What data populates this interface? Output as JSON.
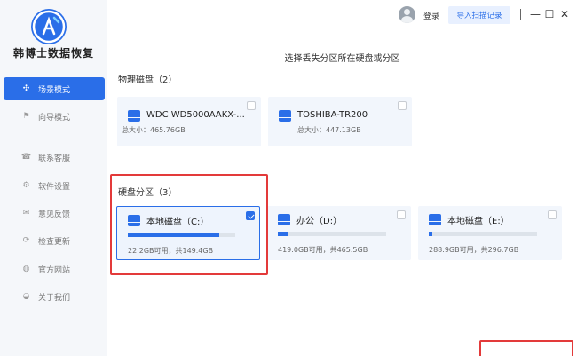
{
  "app": {
    "title": "韩博士数据恢复"
  },
  "sidebar": {
    "items": [
      {
        "label": "场景模式",
        "icon": "scene-icon",
        "glyph": "✣"
      },
      {
        "label": "向导模式",
        "icon": "flag-icon",
        "glyph": "⚑"
      },
      {
        "label": "联系客服",
        "icon": "headset-icon",
        "glyph": "☎"
      },
      {
        "label": "软件设置",
        "icon": "gear-icon",
        "glyph": "⚙"
      },
      {
        "label": "意见反馈",
        "icon": "feedback-icon",
        "glyph": "✉"
      },
      {
        "label": "检查更新",
        "icon": "update-icon",
        "glyph": "⟳"
      },
      {
        "label": "官方网站",
        "icon": "globe-icon",
        "glyph": "◍"
      },
      {
        "label": "关于我们",
        "icon": "info-icon",
        "glyph": "◒"
      }
    ]
  },
  "topbar": {
    "login": "登录",
    "import": "导入扫描记录",
    "separator": "|",
    "minimize": "—",
    "maximize": "☐",
    "close": "✕"
  },
  "main": {
    "heading": "选择丢失分区所在硬盘或分区",
    "physical_title": "物理磁盘（2）",
    "physical_disks": [
      {
        "name": "WDC WD5000AAKX-...",
        "size": "总大小：465.76GB",
        "checked": false
      },
      {
        "name": "TOSHIBA-TR200",
        "size": "总大小：447.13GB",
        "checked": false
      }
    ],
    "partition_title": "硬盘分区（3）",
    "partitions": [
      {
        "name": "本地磁盘（C:）",
        "size": "22.2GB可用，共149.4GB",
        "used_fraction": 0.85,
        "checked": true
      },
      {
        "name": "办公（D:）",
        "size": "419.0GB可用，共465.5GB",
        "used_fraction": 0.1,
        "checked": false
      },
      {
        "name": "本地磁盘（E:）",
        "size": "288.9GB可用，共296.7GB",
        "used_fraction": 0.03,
        "checked": false
      }
    ]
  },
  "colors": {
    "accent": "#2a6ee8",
    "highlight": "#e33a3a"
  }
}
